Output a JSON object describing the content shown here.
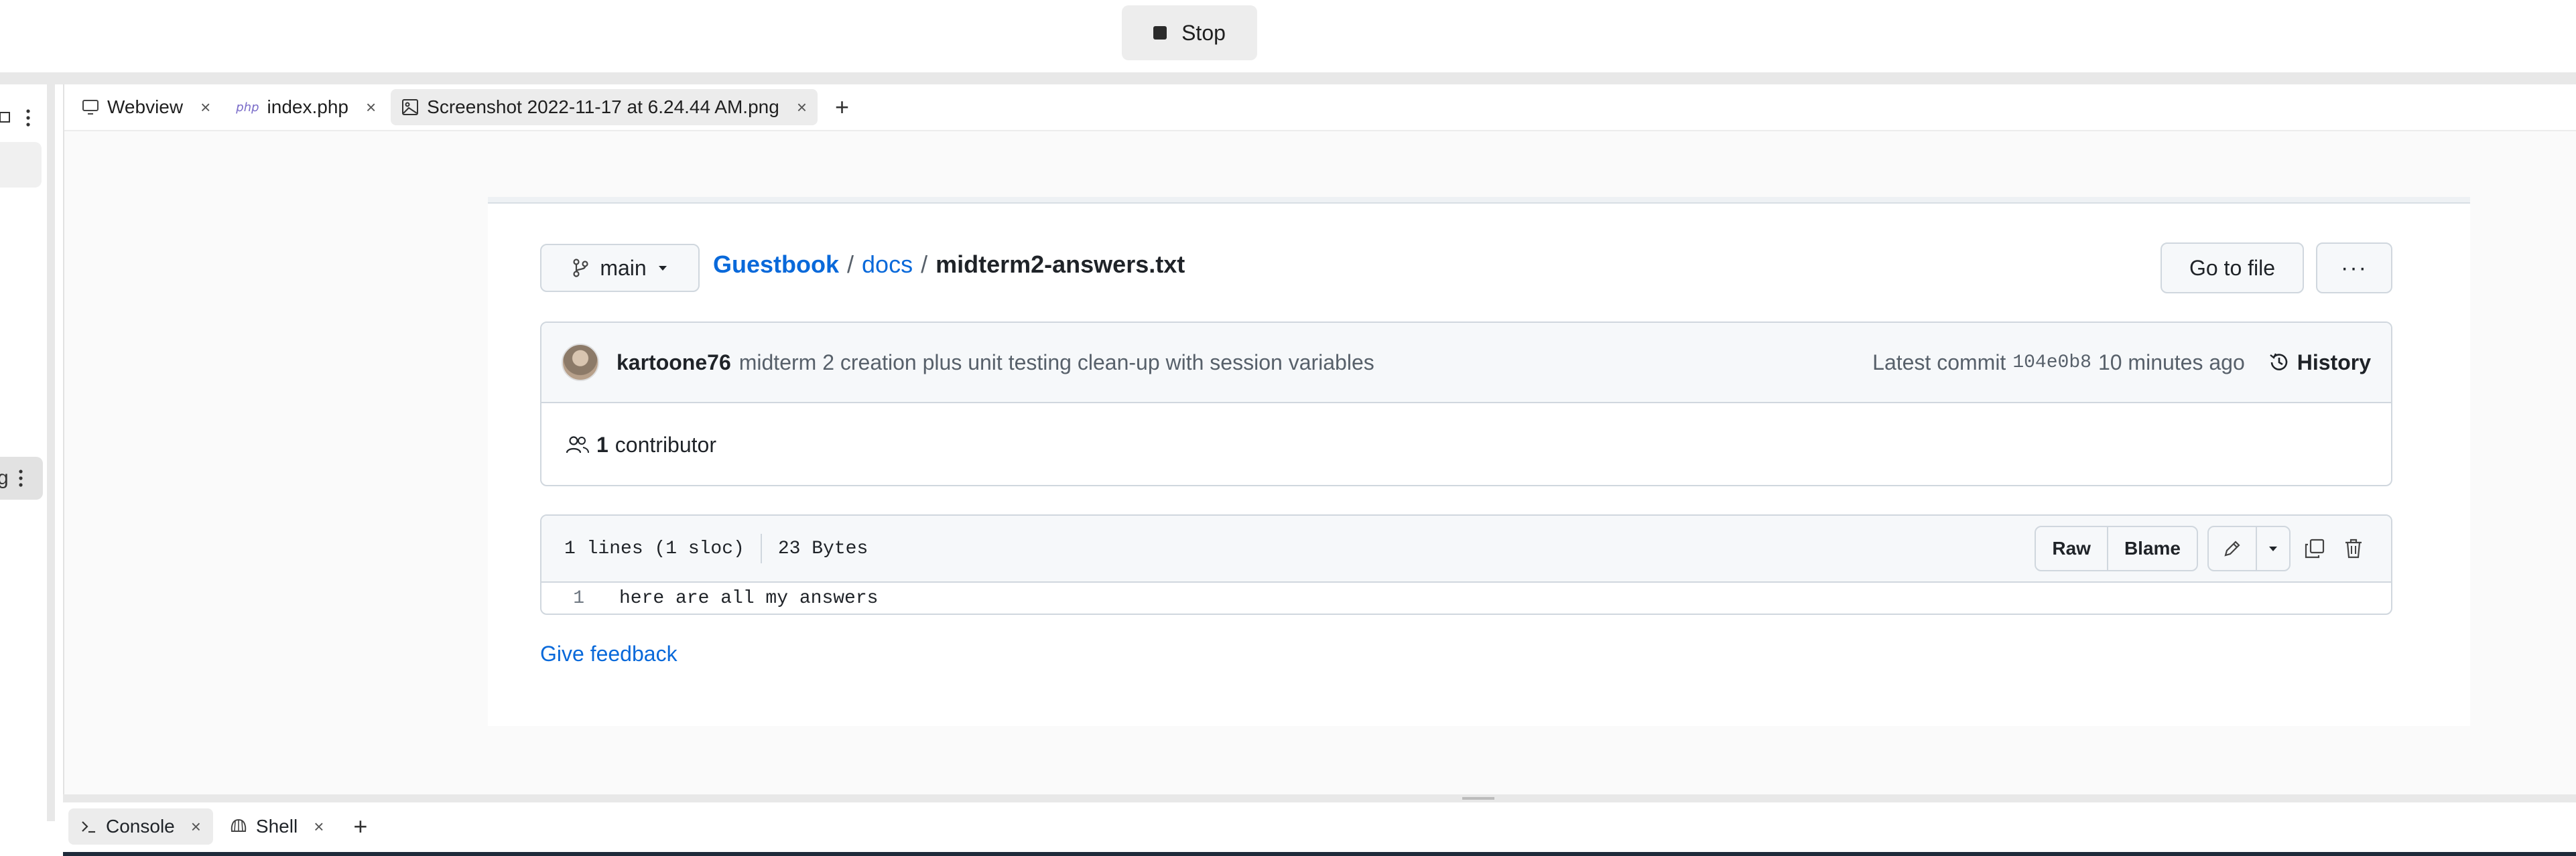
{
  "topbar": {
    "stop_label": "Stop"
  },
  "tabs": [
    {
      "label": "Webview",
      "icon": "monitor-icon"
    },
    {
      "label": "index.php",
      "icon_text": "php"
    },
    {
      "label": "Screenshot 2022-11-17 at 6.24.44 AM.png",
      "icon": "image-icon",
      "active": true
    }
  ],
  "repo": {
    "branch": "main",
    "breadcrumb": {
      "repo": "Guestbook",
      "sep1": "/",
      "folder": "docs",
      "sep2": "/",
      "file": "midterm2-answers.txt"
    },
    "goto_file": "Go to file",
    "more": "···"
  },
  "commit": {
    "author": "kartoone76",
    "message": "midterm 2 creation plus unit testing clean-up with session variables",
    "latest_label": "Latest commit",
    "sha": "104e0b8",
    "time": "10 minutes ago",
    "history": "History"
  },
  "contributors": {
    "count": "1",
    "label": "contributor"
  },
  "file": {
    "lines": "1 lines (1 sloc)",
    "size": "23 Bytes",
    "raw": "Raw",
    "blame": "Blame",
    "code_lines": [
      {
        "num": "1",
        "text": "here are all my answers"
      }
    ]
  },
  "feedback": "Give feedback",
  "bottom_tabs": [
    {
      "label": "Console",
      "icon": "terminal-icon",
      "active": true
    },
    {
      "label": "Shell",
      "icon": "shell-icon"
    }
  ],
  "colors": {
    "link": "#0969da",
    "border": "#d0d7de",
    "muted": "#57606a"
  }
}
